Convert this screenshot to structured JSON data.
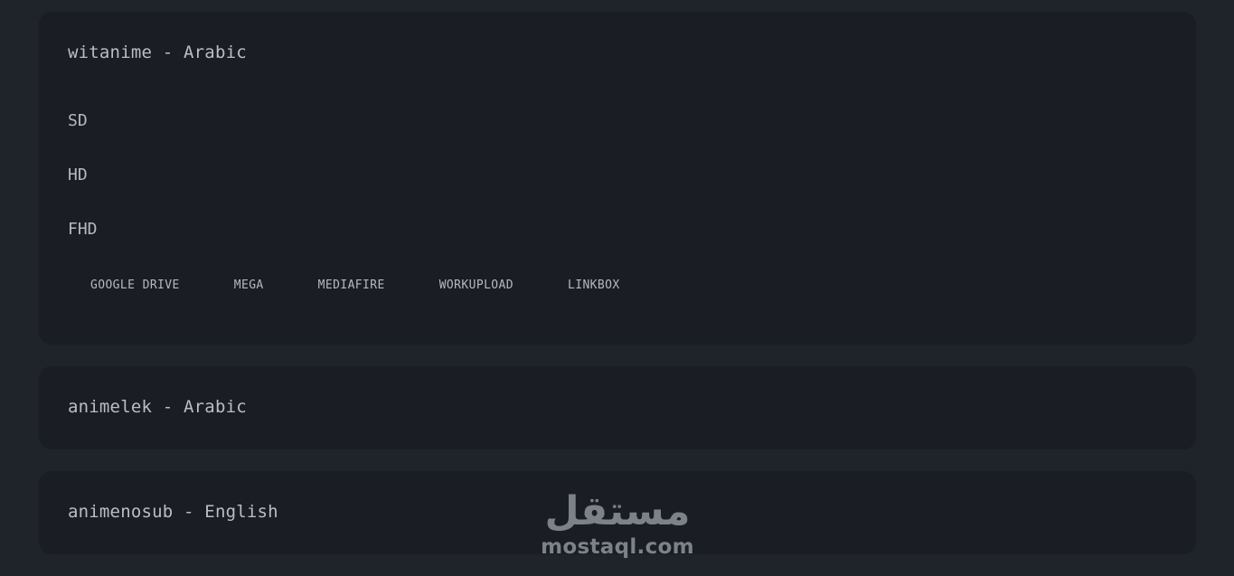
{
  "providers": [
    {
      "title": "witanime - Arabic",
      "qualities": [
        "SD",
        "HD",
        "FHD"
      ],
      "hosts": [
        "GOOGLE DRIVE",
        "MEGA",
        "MEDIAFIRE",
        "WORKUPLOAD",
        "LINKBOX"
      ]
    },
    {
      "title": "animelek - Arabic"
    },
    {
      "title": "animenosub - English"
    }
  ],
  "watermark": {
    "arabic": "مستقل",
    "latin": "mostaql.com"
  }
}
